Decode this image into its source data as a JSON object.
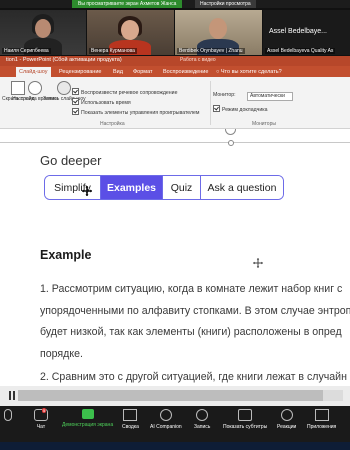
{
  "zoom_top": {
    "share_banner": "Вы просматриваете экран Ахметов Жанса",
    "view_options": "Настройки просмотра"
  },
  "participants": [
    {
      "name": "Наиля Серипбеева"
    },
    {
      "name": "Венера Курманова"
    },
    {
      "name": "Berdibek Orynbayev | Zhanu"
    },
    {
      "name": "Assel Bedelbayeva Quality As",
      "display_name": "Assel Bedelbaye..."
    }
  ],
  "powerpoint": {
    "title": "tion1 - PowerPoint (Сбой активации продукта)",
    "context_tool": "Работа с видео",
    "tabs": [
      {
        "label": "Слайд-шоу",
        "active": true
      },
      {
        "label": "Рецензирование",
        "active": false
      },
      {
        "label": "Вид",
        "active": false
      },
      {
        "label": "Формат",
        "active": false
      },
      {
        "label": "Воспроизведение",
        "active": false
      }
    ],
    "tell_me": "Что вы хотите сделать?",
    "ribbon": {
      "buttons": [
        "Скрыть слайд",
        "Настройка времени",
        "Запись слайд-шоу"
      ],
      "checkboxes": [
        {
          "label": "Воспроизвести речевое сопровождение",
          "checked": true
        },
        {
          "label": "Использовать время",
          "checked": true
        },
        {
          "label": "Показать элементы управления проигрывателем",
          "checked": true
        }
      ],
      "monitor_label": "Монитор:",
      "monitor_value": "Автоматически",
      "presenter_view": "Режим докладчика",
      "presenter_checked": true,
      "groups": [
        "Настройка",
        "Мониторы"
      ]
    }
  },
  "slide": {
    "section_title": "Go deeper",
    "buttons": [
      {
        "label": "Simplify",
        "active": false
      },
      {
        "label": "Examples",
        "active": true
      },
      {
        "label": "Quiz",
        "active": false
      },
      {
        "label": "Ask a question",
        "active": false
      }
    ],
    "example_heading": "Example",
    "para1_lines": [
      "1. Рассмотрим ситуацию, когда в комнате лежит набор книг с",
      "упорядоченными по алфавиту стопками. В этом случае энтроп",
      "будет низкой, так как элементы (книги) расположены в опред",
      "порядке."
    ],
    "para2_lines": [
      "2. Сравним это с другой ситуацией, где книги лежат в случайн"
    ]
  },
  "zoom_toolbar": {
    "items": [
      {
        "label": "",
        "icon": "mic-icon"
      },
      {
        "label": "Чат",
        "icon": "chat-icon",
        "badge": "5"
      },
      {
        "label": "Демонстрация экрана",
        "icon": "share-screen-icon",
        "style": "green"
      },
      {
        "label": "Сводка",
        "icon": "summary-icon"
      },
      {
        "label": "AI Companion",
        "icon": "ai-companion-icon"
      },
      {
        "label": "Запись",
        "icon": "record-icon"
      },
      {
        "label": "Показать субтитры",
        "icon": "cc-icon"
      },
      {
        "label": "Реакции",
        "icon": "reactions-icon"
      },
      {
        "label": "Приложения",
        "icon": "apps-icon"
      }
    ]
  },
  "colors": {
    "pp_red": "#b7472a",
    "accent_purple": "#5b4fe6",
    "share_green": "#2d8c2d"
  }
}
